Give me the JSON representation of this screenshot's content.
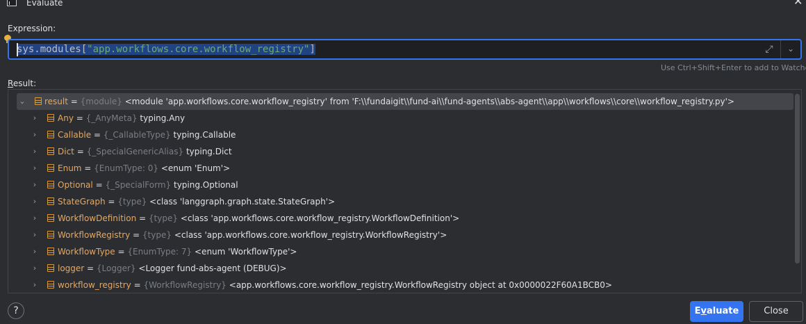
{
  "window": {
    "title": "Evaluate"
  },
  "expression": {
    "label": "Expression:",
    "prefix": "sys.modules[",
    "string": "\"app.workflows.core.workflow_registry\"",
    "suffix": "]",
    "hint": "Use Ctrl+Shift+Enter to add to Watches"
  },
  "result": {
    "label_underlined": "R",
    "label_rest": "esult:",
    "root": {
      "name": "result",
      "type": "{module}",
      "value": "<module 'app.workflows.core.workflow_registry' from 'F:\\\\fundaigit\\\\fund-ai\\\\fund-agents\\\\abs-agent\\\\app\\\\workflows\\\\core\\\\workflow_registry.py'>"
    },
    "children": [
      {
        "name": "Any",
        "type": "{_AnyMeta}",
        "value": "typing.Any"
      },
      {
        "name": "Callable",
        "type": "{_CallableType}",
        "value": "typing.Callable"
      },
      {
        "name": "Dict",
        "type": "{_SpecialGenericAlias}",
        "value": "typing.Dict"
      },
      {
        "name": "Enum",
        "type": "{EnumType: 0}",
        "value": "<enum 'Enum'>"
      },
      {
        "name": "Optional",
        "type": "{_SpecialForm}",
        "value": "typing.Optional"
      },
      {
        "name": "StateGraph",
        "type": "{type}",
        "value": "<class 'langgraph.graph.state.StateGraph'>"
      },
      {
        "name": "WorkflowDefinition",
        "type": "{type}",
        "value": "<class 'app.workflows.core.workflow_registry.WorkflowDefinition'>"
      },
      {
        "name": "WorkflowRegistry",
        "type": "{type}",
        "value": "<class 'app.workflows.core.workflow_registry.WorkflowRegistry'>"
      },
      {
        "name": "WorkflowType",
        "type": "{EnumType: 7}",
        "value": "<enum 'WorkflowType'>"
      },
      {
        "name": "logger",
        "type": "{Logger}",
        "value": "<Logger fund-abs-agent (DEBUG)>"
      },
      {
        "name": "workflow_registry",
        "type": "{WorkflowRegistry}",
        "value": "<app.workflows.core.workflow_registry.WorkflowRegistry object at 0x0000022F60A1BCB0>"
      }
    ]
  },
  "buttons": {
    "help": "?",
    "evaluate_pre": "E",
    "evaluate_mnemonic": "v",
    "evaluate_post": "aluate",
    "close": "Close"
  },
  "colors": {
    "accent": "#3574f0",
    "var_name": "#e8a75f",
    "type_hint": "#7a7e85",
    "string": "#6aab73",
    "background": "#2b2d30"
  }
}
